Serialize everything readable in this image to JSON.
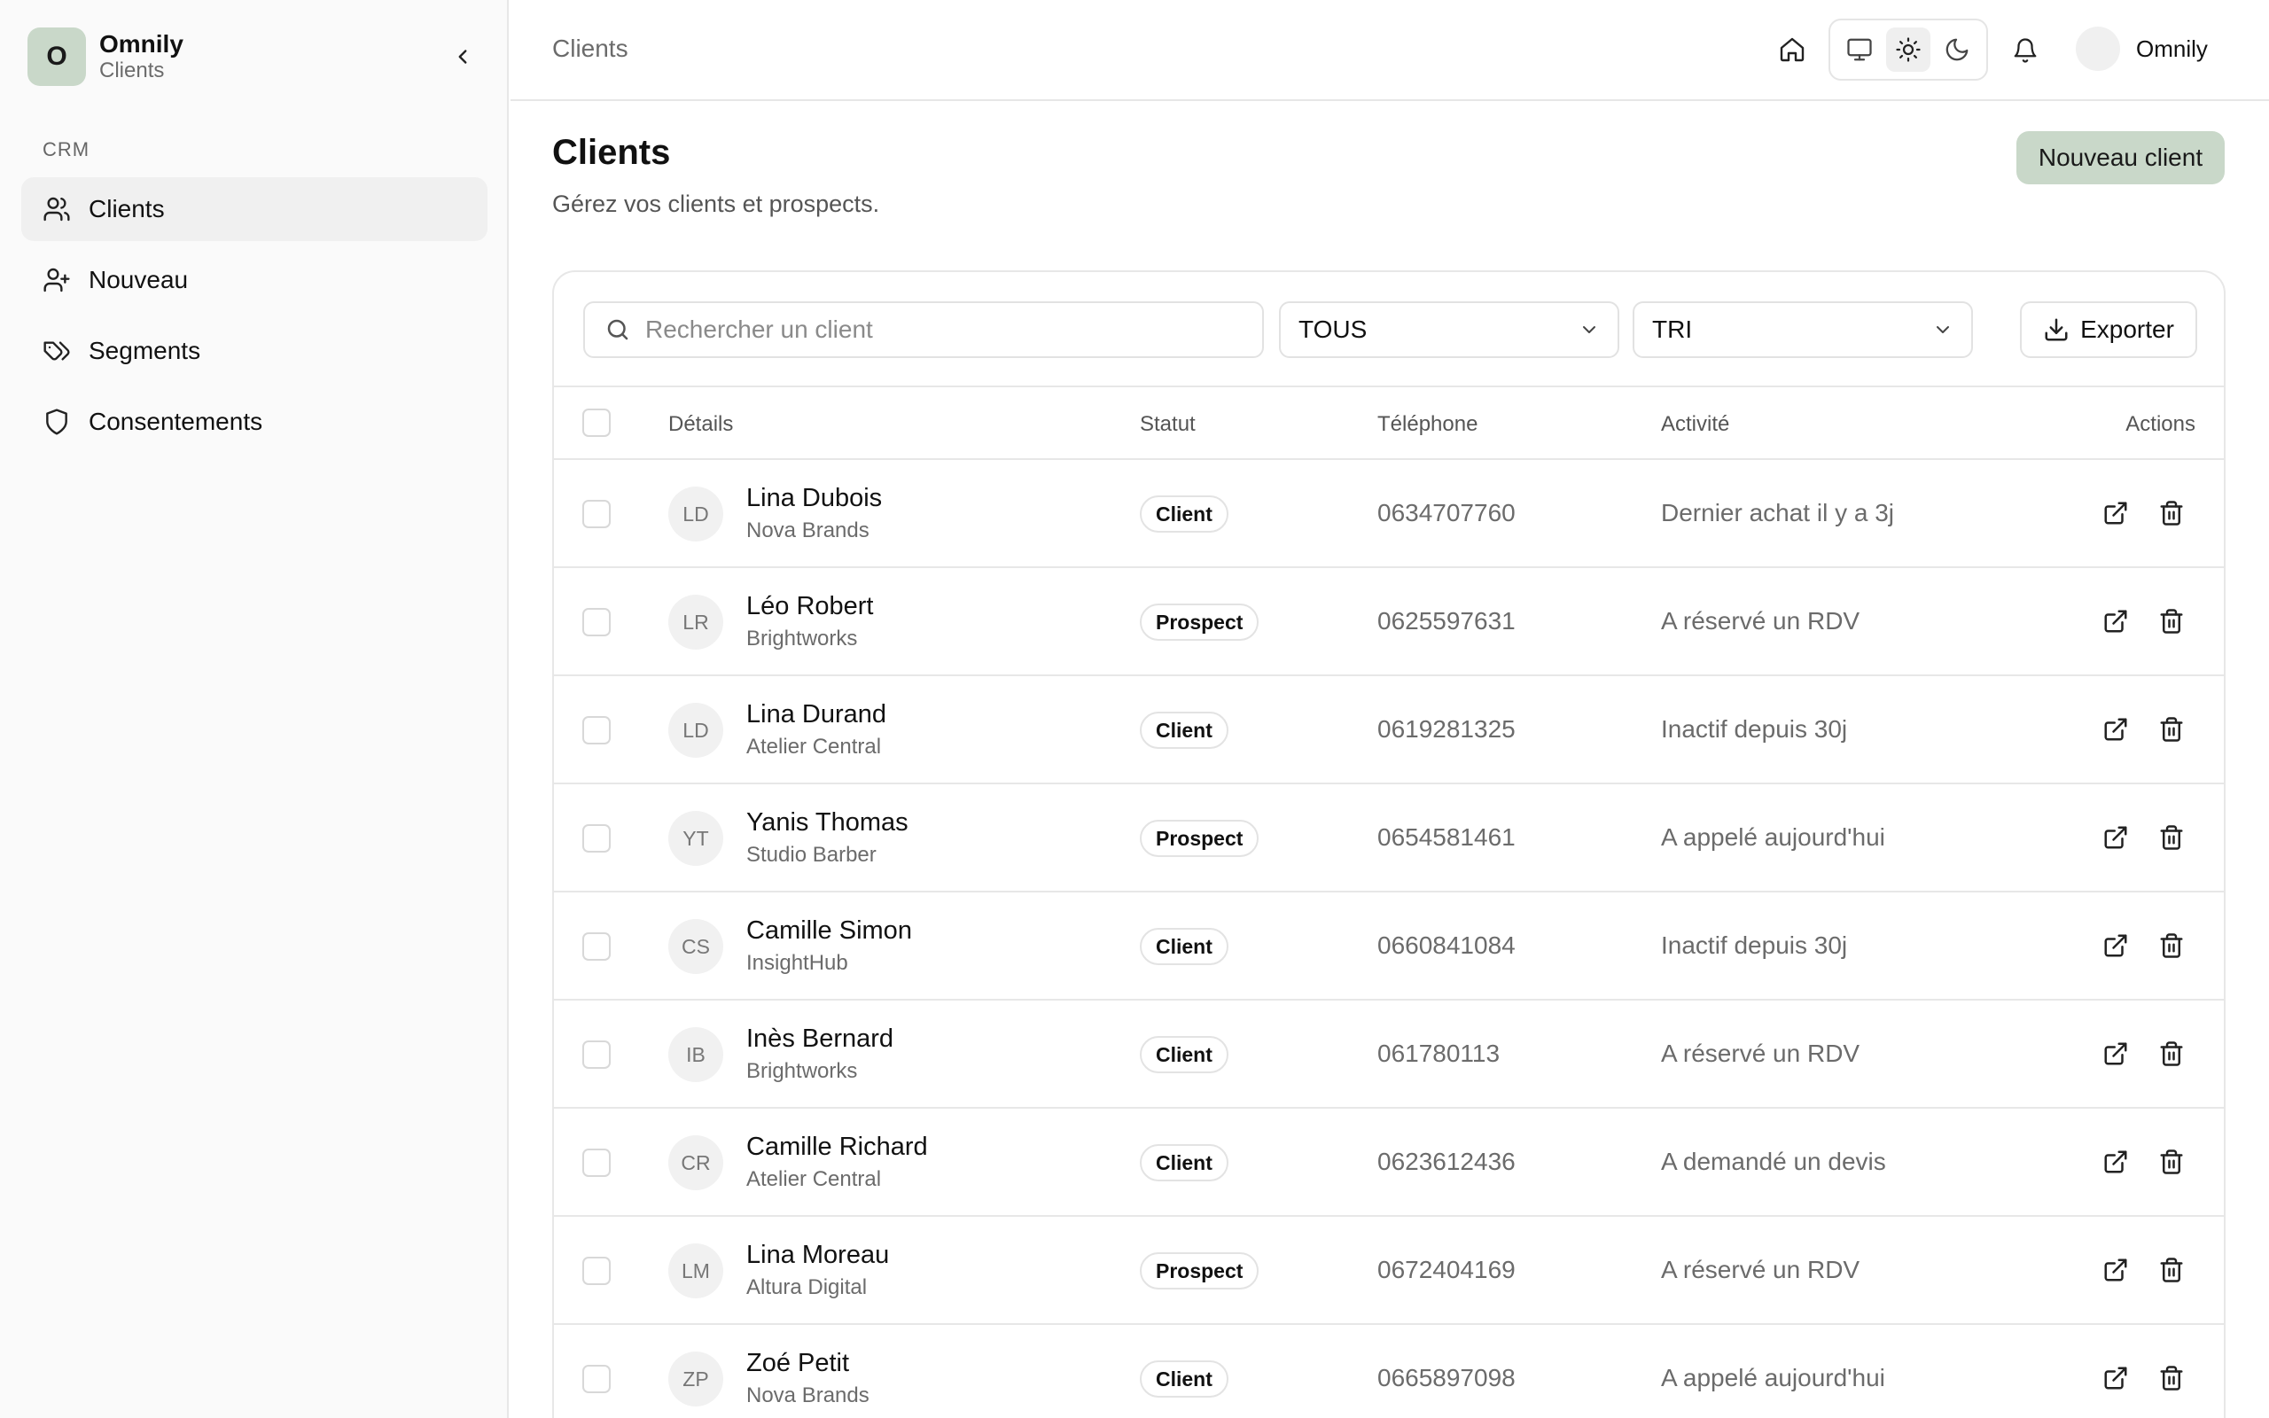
{
  "sidebar": {
    "brand_initial": "O",
    "brand_name": "Omnily",
    "brand_sub": "Clients",
    "section": "CRM",
    "items": [
      {
        "label": "Clients",
        "icon": "users-icon",
        "active": true
      },
      {
        "label": "Nouveau",
        "icon": "user-plus-icon",
        "active": false
      },
      {
        "label": "Segments",
        "icon": "tags-icon",
        "active": false
      },
      {
        "label": "Consentements",
        "icon": "shield-icon",
        "active": false
      }
    ]
  },
  "topbar": {
    "breadcrumb": "Clients",
    "user_name": "Omnily",
    "theme_selected": "light"
  },
  "main": {
    "title": "Clients",
    "subtitle": "Gérez vos clients et prospects.",
    "new_button": "Nouveau client",
    "search_placeholder": "Rechercher un client",
    "filter_status": "TOUS",
    "sort": "TRI",
    "export_label": "Exporter",
    "columns": {
      "details": "Détails",
      "status": "Statut",
      "phone": "Téléphone",
      "activity": "Activité",
      "actions": "Actions"
    },
    "rows": [
      {
        "initials": "LD",
        "name": "Lina Dubois",
        "company": "Nova Brands",
        "status": "Client",
        "phone": "0634707760",
        "activity": "Dernier achat il y a 3j"
      },
      {
        "initials": "LR",
        "name": "Léo Robert",
        "company": "Brightworks",
        "status": "Prospect",
        "phone": "0625597631",
        "activity": "A réservé un RDV"
      },
      {
        "initials": "LD",
        "name": "Lina Durand",
        "company": "Atelier Central",
        "status": "Client",
        "phone": "0619281325",
        "activity": "Inactif depuis 30j"
      },
      {
        "initials": "YT",
        "name": "Yanis Thomas",
        "company": "Studio Barber",
        "status": "Prospect",
        "phone": "0654581461",
        "activity": "A appelé aujourd'hui"
      },
      {
        "initials": "CS",
        "name": "Camille Simon",
        "company": "InsightHub",
        "status": "Client",
        "phone": "0660841084",
        "activity": "Inactif depuis 30j"
      },
      {
        "initials": "IB",
        "name": "Inès Bernard",
        "company": "Brightworks",
        "status": "Client",
        "phone": "061780113",
        "activity": "A réservé un RDV"
      },
      {
        "initials": "CR",
        "name": "Camille Richard",
        "company": "Atelier Central",
        "status": "Client",
        "phone": "0623612436",
        "activity": "A demandé un devis"
      },
      {
        "initials": "LM",
        "name": "Lina Moreau",
        "company": "Altura Digital",
        "status": "Prospect",
        "phone": "0672404169",
        "activity": "A réservé un RDV"
      },
      {
        "initials": "ZP",
        "name": "Zoé Petit",
        "company": "Nova Brands",
        "status": "Client",
        "phone": "0665897098",
        "activity": "A appelé aujourd'hui"
      }
    ]
  },
  "colors": {
    "accent": "#c9d8c9",
    "sidebar_bg": "#fafafa",
    "border": "#e7e7e7"
  }
}
